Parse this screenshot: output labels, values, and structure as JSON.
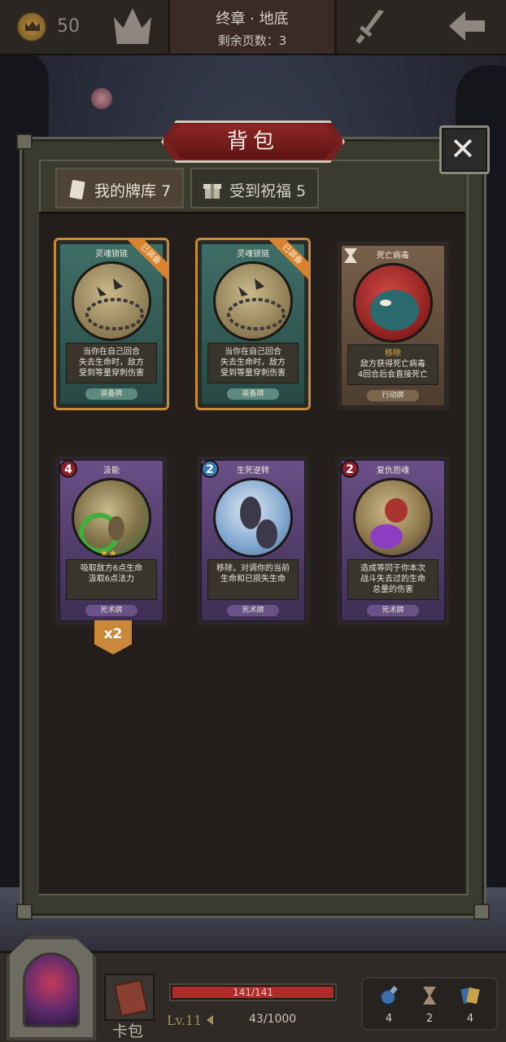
{
  "header": {
    "gold": "50",
    "chapter_title": "终章 · 地底",
    "pages_remaining": "剩余页数：3"
  },
  "panel": {
    "title": "背包",
    "close_glyph": "✕",
    "tabs": [
      {
        "label": "我的牌库 7",
        "active": true
      },
      {
        "label": "受到祝福 5",
        "active": false
      }
    ]
  },
  "cards": [
    {
      "name": "灵魂锁链",
      "badge": "已装备",
      "desc": [
        "当你在自己回合",
        "失去生命时，敌方",
        "受到等量穿刺伤害"
      ],
      "highlight": "",
      "type": "装备牌",
      "cost": ""
    },
    {
      "name": "灵魂锁链",
      "badge": "已装备",
      "desc": [
        "当你在自己回合",
        "失去生命时，敌方",
        "受到等量穿刺伤害"
      ],
      "highlight": "",
      "type": "装备牌",
      "cost": ""
    },
    {
      "name": "死亡病毒",
      "badge": "",
      "desc": [
        "敌方获得死亡病毒",
        "4回合后会直接死亡"
      ],
      "highlight": "移除",
      "type": "行动牌",
      "cost": ""
    },
    {
      "name": "汲能",
      "badge": "",
      "desc": [
        "吸取敌方6点生命",
        "汲取6点法力"
      ],
      "highlight": "",
      "type": "死术牌",
      "cost": "4",
      "count": "x2"
    },
    {
      "name": "生死逆转",
      "badge": "",
      "desc": [
        "移除，对调你的当前",
        "生命和已损失生命"
      ],
      "highlight": "",
      "type": "死术牌",
      "cost": "2"
    },
    {
      "name": "复仇怨魂",
      "badge": "",
      "desc": [
        "造成等同于你本次",
        "战斗失去过的生命",
        "总量的伤害"
      ],
      "highlight": "",
      "type": "死术牌",
      "cost": "2"
    }
  ],
  "bottom": {
    "deck_label": "卡包",
    "hp_text": "141/141",
    "hp_fraction": 1.0,
    "level": "Lv.11",
    "xp_text": "43/1000",
    "stats": [
      {
        "icon": "potion-icon",
        "value": "4"
      },
      {
        "icon": "hourglass-icon",
        "value": "2"
      },
      {
        "icon": "cards-icon",
        "value": "4"
      }
    ]
  },
  "colors": {
    "accent_red": "#7a1f1f",
    "equipped_orange": "#d9822f",
    "hp_red": "#b02a2a",
    "highlight_gold": "#e2a940"
  }
}
